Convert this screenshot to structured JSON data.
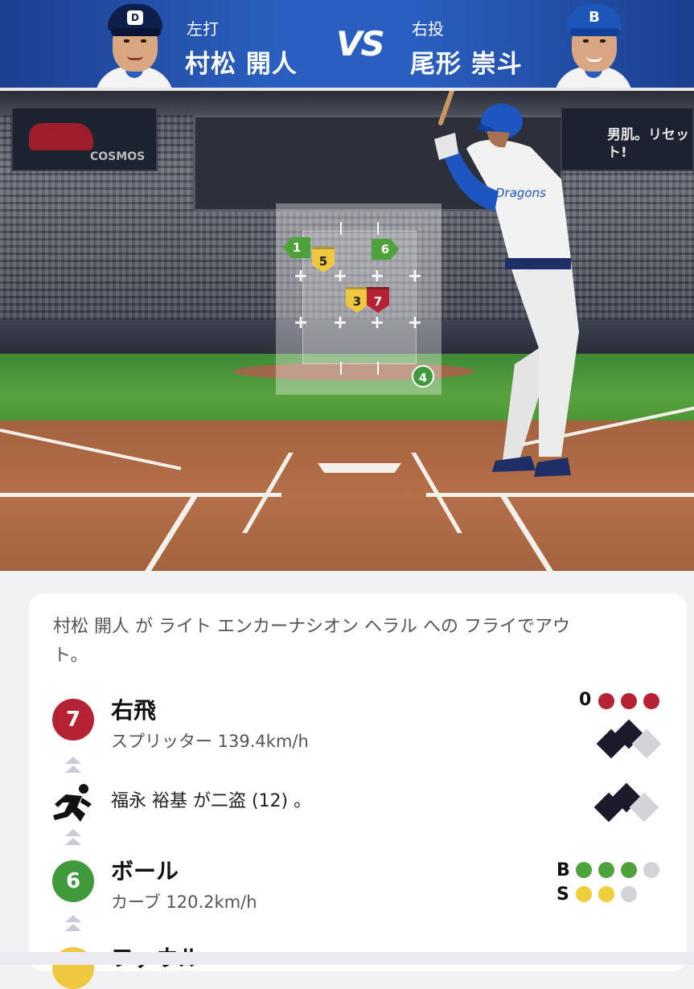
{
  "matchup": {
    "batter_side": "左打",
    "batter_name": "村松 開人",
    "vs": "VS",
    "pitcher_side": "右投",
    "pitcher_name": "尾形 崇斗"
  },
  "scene": {
    "ad_left": "COSMOS",
    "ad_right": "男肌。リセット!",
    "jersey": "Dragons"
  },
  "pitches": [
    {
      "n": "1",
      "type": "greenflag"
    },
    {
      "n": "5",
      "type": "yellow"
    },
    {
      "n": "6",
      "type": "greenflag"
    },
    {
      "n": "3",
      "type": "yellow"
    },
    {
      "n": "7",
      "type": "red"
    },
    {
      "n": "4",
      "type": "greencircle"
    }
  ],
  "play_log": {
    "summary": "村松 開人 が ライト エンカーナシオン ヘラル への フライでアウト。",
    "rows": [
      {
        "badge": "7",
        "badge_color": "#b42234",
        "title": "右飛",
        "subtitle": "スプリッター 139.4km/h",
        "outs_label": "0"
      },
      {
        "icon": "running-icon",
        "text": "福永 裕基 が二盗 (12) 。"
      },
      {
        "badge": "6",
        "badge_color": "#3e9a3a",
        "title": "ボール",
        "subtitle": "カーブ 120.2km/h",
        "b_label": "B",
        "s_label": "S"
      },
      {
        "title": "ファウル"
      }
    ]
  },
  "colors": {
    "header": "#2a5fbf",
    "out_dot": "#b42234",
    "ball_dot": "#4ea23a",
    "strike_dot": "#f0cf3c",
    "empty_dot": "#d4d4d8"
  }
}
